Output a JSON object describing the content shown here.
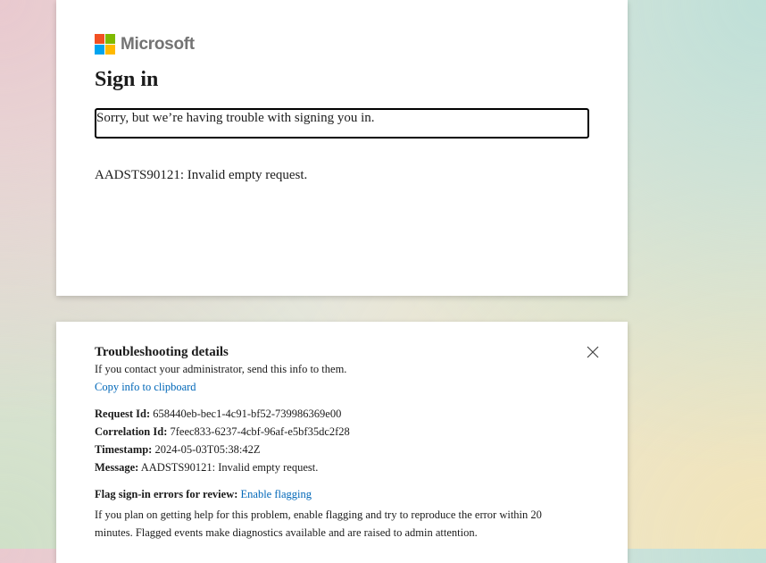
{
  "brand": {
    "name": "Microsoft",
    "logo_colors": [
      "#f25022",
      "#7fba00",
      "#00a4ef",
      "#ffb900"
    ]
  },
  "signin": {
    "title": "Sign in",
    "error_message": "Sorry, but we’re having trouble with signing you in.",
    "error_code": "AADSTS90121: Invalid empty request."
  },
  "troubleshooting": {
    "title": "Troubleshooting details",
    "intro": "If you contact your administrator, send this info to them.",
    "copy_link": "Copy info to clipboard",
    "close_icon": "close-icon",
    "fields": {
      "request_id_label": "Request Id:",
      "request_id": "658440eb-bec1-4c91-bf52-739986369e00",
      "correlation_id_label": "Correlation Id:",
      "correlation_id": "7feec833-6237-4cbf-96af-e5bf35dc2f28",
      "timestamp_label": "Timestamp:",
      "timestamp": "2024-05-03T05:38:42Z",
      "message_label": "Message:",
      "message": "AADSTS90121: Invalid empty request."
    },
    "flag_label": "Flag sign-in errors for review:",
    "flag_link": "Enable flagging",
    "flag_description": "If you plan on getting help for this problem, enable flagging and try to reproduce the error within 20 minutes. Flagged events make diagnostics available and are raised to admin attention."
  },
  "colors": {
    "link": "#0067b8",
    "text": "#1b1b1b"
  }
}
